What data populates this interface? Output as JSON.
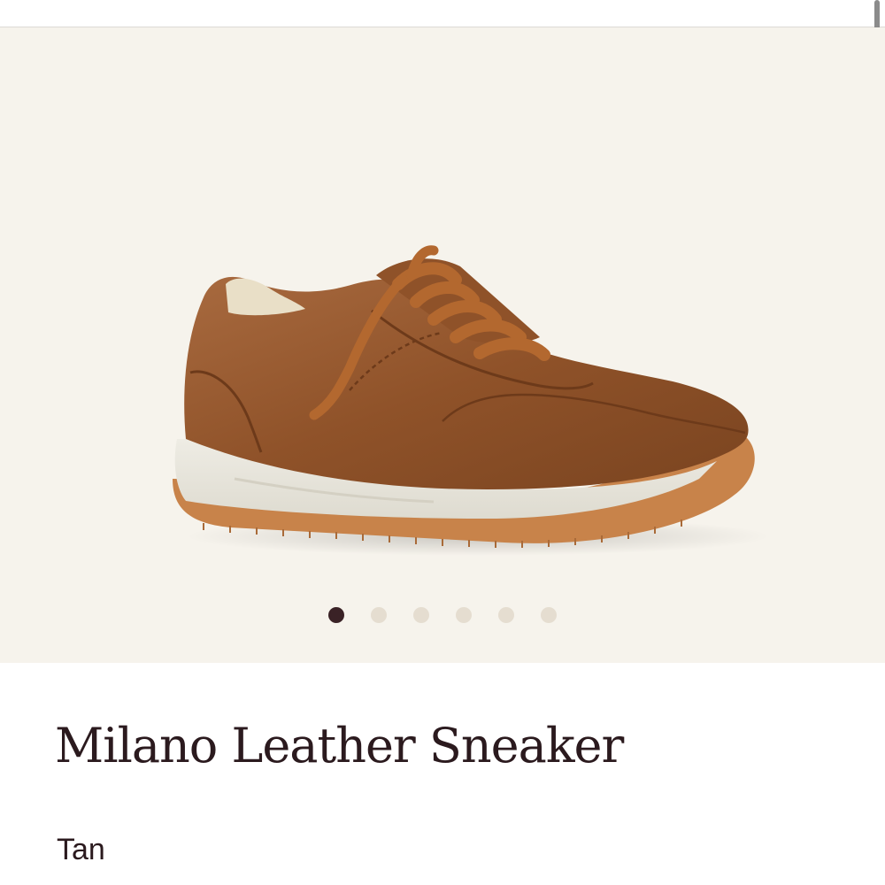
{
  "product": {
    "title": "Milano Leather Sneaker",
    "color_name": "Tan"
  },
  "gallery": {
    "image_alt": "sneaker-product-image",
    "slide_count": 6,
    "active_slide": 1
  },
  "colors": {
    "gallery_bg": "#f6f3ec",
    "text": "#2b1a1e",
    "dot_active": "#3a2226",
    "dot_inactive": "#e5ddd0",
    "leather": "#9a5a32",
    "laces": "#b3682f",
    "sole": "#e8e6dc",
    "outsole": "#c8834a"
  }
}
